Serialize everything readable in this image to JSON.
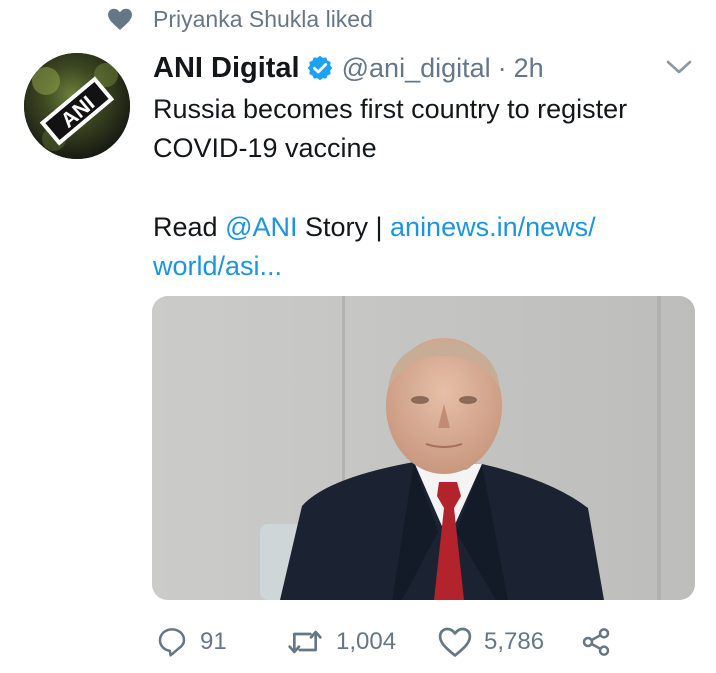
{
  "social_context": {
    "icon": "heart-icon",
    "text": "Priyanka Shukla liked"
  },
  "tweet": {
    "avatar": {
      "icon": "ani-logo",
      "logo_text": "ANI"
    },
    "display_name": "ANI Digital",
    "verified": true,
    "handle": "@ani_digital",
    "separator": "·",
    "time": "2h",
    "text_line1": "Russia becomes first country to register COVID-19 vaccine",
    "read_prefix": "Read ",
    "mention": "@ANI",
    "read_middle": " Story | ",
    "link": "aninews.in/news/ world/asi..."
  },
  "actions": {
    "reply_count": "91",
    "retweet_count": "1,004",
    "like_count": "5,786"
  },
  "colors": {
    "text": "#14171a",
    "secondary": "#657786",
    "link": "#1b95e0",
    "verified": "#1da1f2"
  }
}
